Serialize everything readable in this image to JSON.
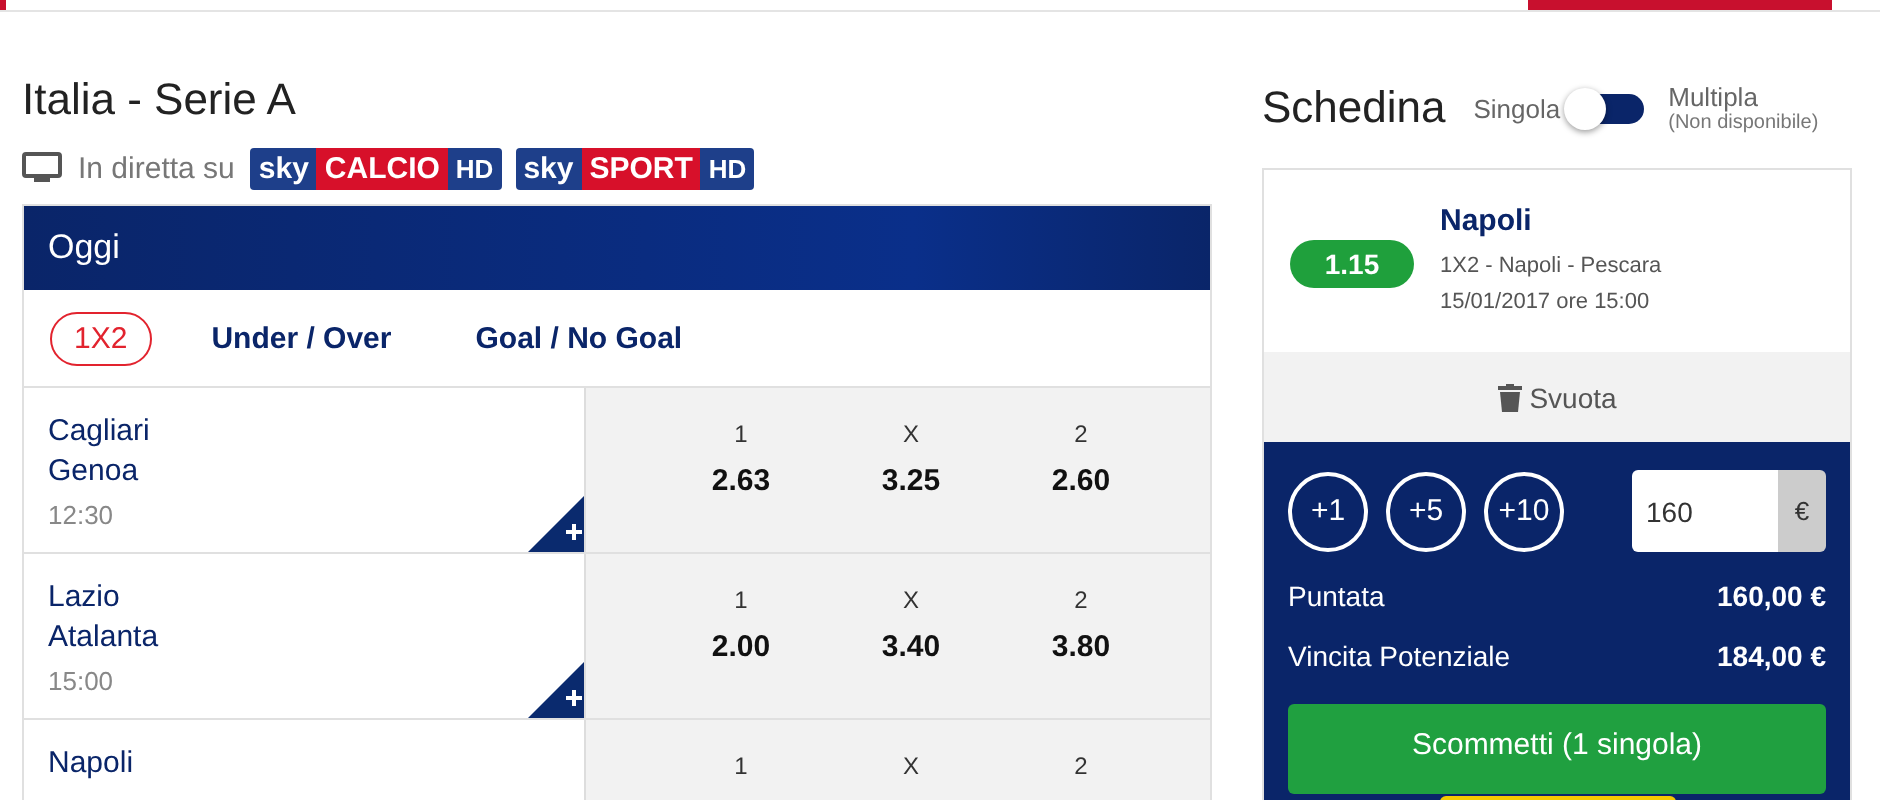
{
  "league": {
    "title": "Italia - Serie A",
    "live_label": "In diretta su",
    "channels": [
      {
        "brand": "sky",
        "name": "CALCIO",
        "suffix": "HD"
      },
      {
        "brand": "sky",
        "name": "SPORT",
        "suffix": "HD"
      }
    ]
  },
  "panel": {
    "header": "Oggi",
    "markets": [
      {
        "label": "1X2",
        "selected": true
      },
      {
        "label": "Under / Over",
        "selected": false
      },
      {
        "label": "Goal / No Goal",
        "selected": false
      }
    ],
    "matches": [
      {
        "home": "Cagliari",
        "away": "Genoa",
        "time": "12:30",
        "odds": [
          {
            "label": "1",
            "value": "2.63"
          },
          {
            "label": "X",
            "value": "3.25"
          },
          {
            "label": "2",
            "value": "2.60"
          }
        ]
      },
      {
        "home": "Lazio",
        "away": "Atalanta",
        "time": "15:00",
        "odds": [
          {
            "label": "1",
            "value": "2.00"
          },
          {
            "label": "X",
            "value": "3.40"
          },
          {
            "label": "2",
            "value": "3.80"
          }
        ]
      },
      {
        "home": "Napoli",
        "odds": [
          {
            "label": "1"
          },
          {
            "label": "X"
          },
          {
            "label": "2"
          }
        ]
      }
    ]
  },
  "slip": {
    "title": "Schedina",
    "toggle": {
      "left_label": "Singola",
      "right_label": "Multipla",
      "right_note": "(Non disponibile)",
      "multiple": false
    },
    "bet": {
      "odd": "1.15",
      "selection": "Napoli",
      "market": "1X2 - Napoli - Pescara",
      "date": "15/01/2017 ore 15:00"
    },
    "clear_label": "Svuota",
    "quick_stakes": [
      "+1",
      "+5",
      "+10"
    ],
    "stake": {
      "value": "160",
      "currency": "€"
    },
    "summary": [
      {
        "label": "Puntata",
        "value": "160,00 €"
      },
      {
        "label": "Vincita Potenziale",
        "value": "184,00 €"
      }
    ],
    "submit": "Scommetti (1 singola)"
  }
}
